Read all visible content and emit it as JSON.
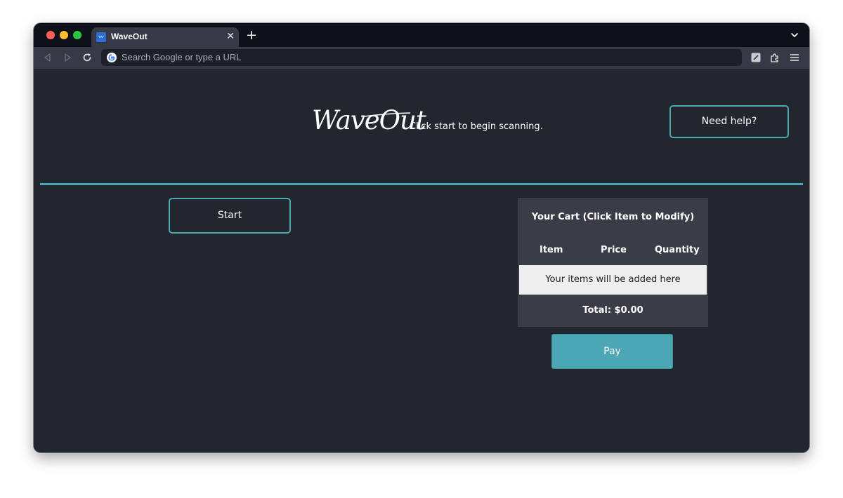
{
  "browser": {
    "tab": {
      "title": "WaveOut",
      "favicon": "waveout-favicon-icon",
      "close_glyph": "✕"
    },
    "new_tab_glyph": "+",
    "address_bar": {
      "placeholder": "Search Google or type a URL"
    },
    "icons": [
      "back-icon",
      "forward-icon",
      "reload-icon",
      "google-icon",
      "extension-icon",
      "puzzle-icon",
      "menu-icon",
      "chevron-down-icon"
    ]
  },
  "app": {
    "logo_text": "WaveOut",
    "subtitle": "Click start to begin scanning.",
    "help_label": "Need help?",
    "start_label": "Start",
    "cart": {
      "title": "Your Cart (Click Item to Modify)",
      "columns": [
        "Item",
        "Price",
        "Quantity"
      ],
      "empty_message": "Your items will be added here",
      "total": "Total: $0.00"
    },
    "pay_label": "Pay"
  },
  "colors": {
    "accent": "#4ba7b4",
    "background": "#22262f",
    "cart_panel": "#3a3d47",
    "tabstrip": "#0f111a",
    "toolbar": "#363a47"
  }
}
